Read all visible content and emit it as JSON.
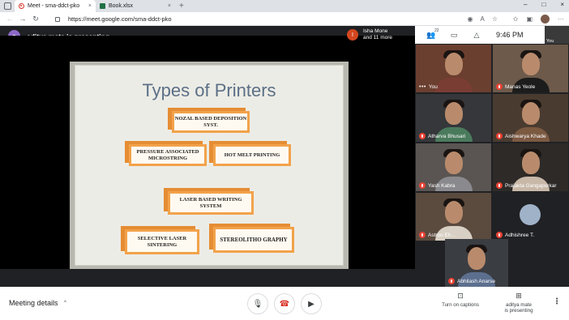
{
  "browser": {
    "tabs": [
      {
        "title": "Meet - sma-ddct-pko",
        "close": "×"
      },
      {
        "title": "Book.xlsx",
        "close": "×"
      }
    ],
    "new_tab": "+",
    "window_controls": [
      "–",
      "□",
      "×"
    ],
    "url": "https://meet.google.com/sma-ddct-pko"
  },
  "presenting": {
    "avatar_letter": "a",
    "text": "aditya mate is presenting"
  },
  "slide": {
    "title": "Types of Printers",
    "boxes": [
      {
        "text": "NOZAL BASED DEPOSITION SYST."
      },
      {
        "text": "PRESSURE ASSOCIATED MICROSTRING"
      },
      {
        "text": "HOT MELT PRINTING"
      },
      {
        "text": "LASER BASED WRITING SYSTEM"
      },
      {
        "text": "SELECTIVE LASER SINTERING"
      },
      {
        "text": "STEREOLITHO GRAPHY"
      }
    ]
  },
  "top_info": {
    "avatar_letter": "I",
    "line1": "Isha Mone",
    "line2": "and 11 more"
  },
  "top_controls": {
    "people_count": "22",
    "time": "9:46 PM",
    "self_label": "You"
  },
  "participants": [
    {
      "name": "You",
      "muted": false,
      "self": true
    },
    {
      "name": "Manas Yeole",
      "muted": true
    },
    {
      "name": "Atharva Bhusari",
      "muted": true
    },
    {
      "name": "Aishwarya Khade",
      "muted": true
    },
    {
      "name": "Yash Kabra",
      "muted": true
    },
    {
      "name": "Prajakta Gangapurkar",
      "muted": true
    },
    {
      "name": "Astron Eh...",
      "muted": true
    },
    {
      "name": "Adhishree T.",
      "muted": true
    },
    {
      "name": "Abhilash Anarse",
      "muted": true
    }
  ],
  "bottom": {
    "meeting_details": "Meeting details",
    "captions_label": "Turn on captions",
    "present_label_1": "aditya mate",
    "present_label_2": "is presenting"
  },
  "colors": {
    "accent_orange": "#f2a24a",
    "title_blue": "#5b6f86",
    "hangup_red": "#d93025"
  }
}
